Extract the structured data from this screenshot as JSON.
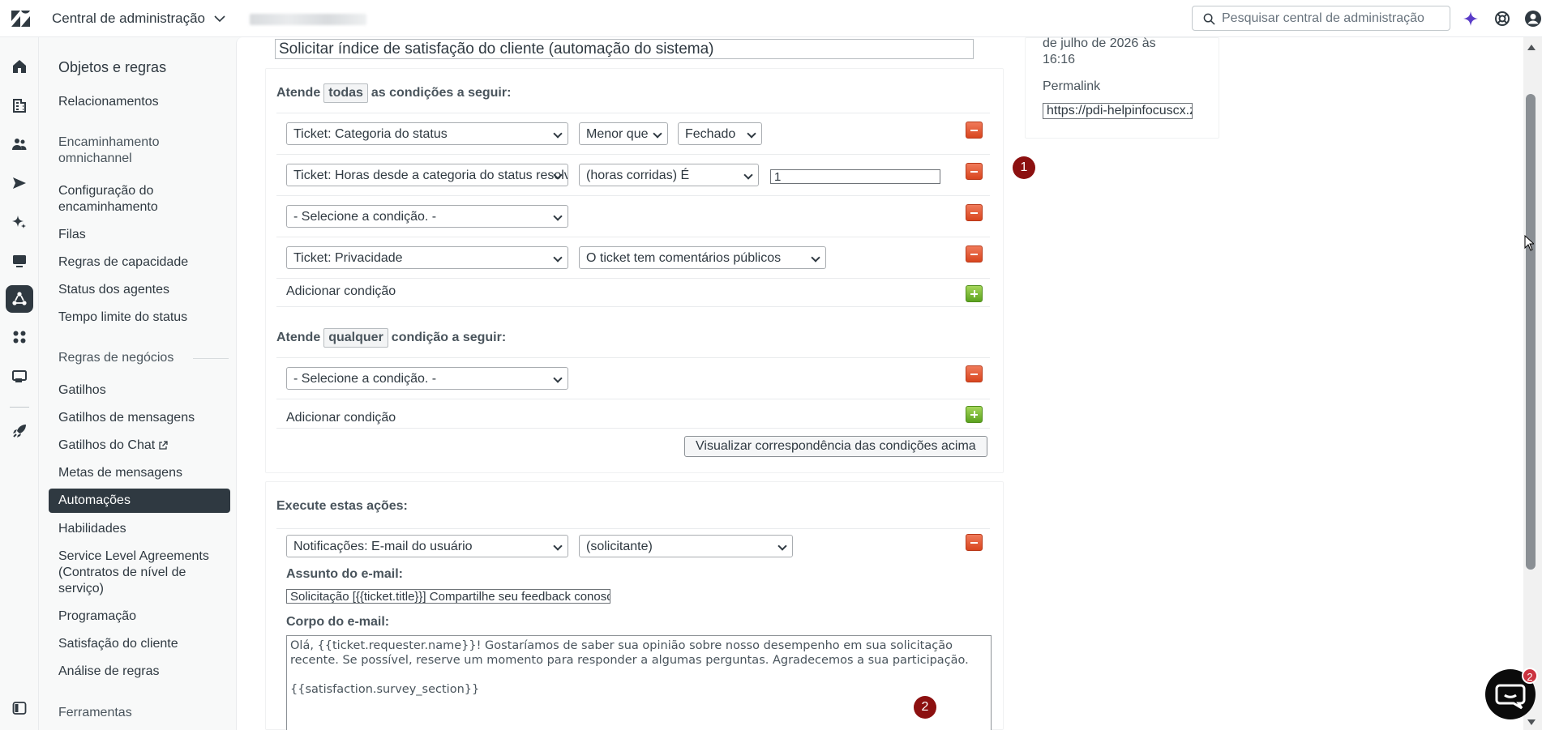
{
  "header": {
    "app_title": "Central de administração",
    "search_placeholder": "Pesquisar central de administração"
  },
  "nav": {
    "section_title": "Objetos e regras",
    "items_top": [
      "Relacionamentos"
    ],
    "group_routing": "Encaminhamento omnichannel",
    "routing_items": [
      "Configuração do encaminhamento",
      "Filas",
      "Regras de capacidade",
      "Status dos agentes",
      "Tempo limite do status"
    ],
    "group_business": "Regras de negócios",
    "business_items": [
      "Gatilhos",
      "Gatilhos de mensagens",
      "Gatilhos do Chat",
      "Metas de mensagens",
      "Automações",
      "Habilidades",
      "Service Level Agreements (Contratos de nível de serviço)",
      "Programação",
      "Satisfação do cliente",
      "Análise de regras"
    ],
    "group_tools": "Ferramentas"
  },
  "automation": {
    "title": "Solicitar índice de satisfação do cliente (automação do sistema)",
    "all_heading": {
      "prefix": "Atende",
      "selector": "todas",
      "suffix": "as condições a seguir:"
    },
    "all_conditions": [
      {
        "field": "Ticket: Categoria do status",
        "operator": "Menor que",
        "value": "Fechado"
      },
      {
        "field": "Ticket: Horas desde a categoria do status resolvido",
        "operator": "(horas corridas) É",
        "value": "1"
      },
      {
        "field": "- Selecione a condição. -"
      },
      {
        "field": "Ticket: Privacidade",
        "operator": "O ticket tem comentários públicos"
      }
    ],
    "add_condition_label": "Adicionar condição",
    "any_heading": {
      "prefix": "Atende",
      "selector": "qualquer",
      "suffix": "condição a seguir:"
    },
    "any_conditions": [
      {
        "field": "- Selecione a condição. -"
      }
    ],
    "add_condition_label_2": "Adicionar condição",
    "preview_button": "Visualizar correspondência das condições acima",
    "actions_heading": "Execute estas ações:",
    "action": {
      "field": "Notificações: E-mail do usuário",
      "target": "(solicitante)"
    },
    "email_subject_label": "Assunto do e-mail:",
    "email_subject": "Solicitação [{{ticket.title}}] Compartilhe seu feedback conosco",
    "email_body_label": "Corpo do e-mail:",
    "email_body": "Olá, {{ticket.requester.name}}! Gostaríamos de saber sua opinião sobre nosso desempenho em sua solicitação recente. Se possível, reserve um momento para responder a algumas perguntas. Agradecemos a sua participação.\n\n{{satisfaction.survey_section}}"
  },
  "side": {
    "updated_text": "de julho de 2026 às 16:16",
    "permalink_label": "Permalink",
    "permalink_value": "https://pdi-helpinfocuscx.zendesk.com"
  },
  "badges": {
    "one": "1",
    "two": "2",
    "chat_count": "2"
  }
}
